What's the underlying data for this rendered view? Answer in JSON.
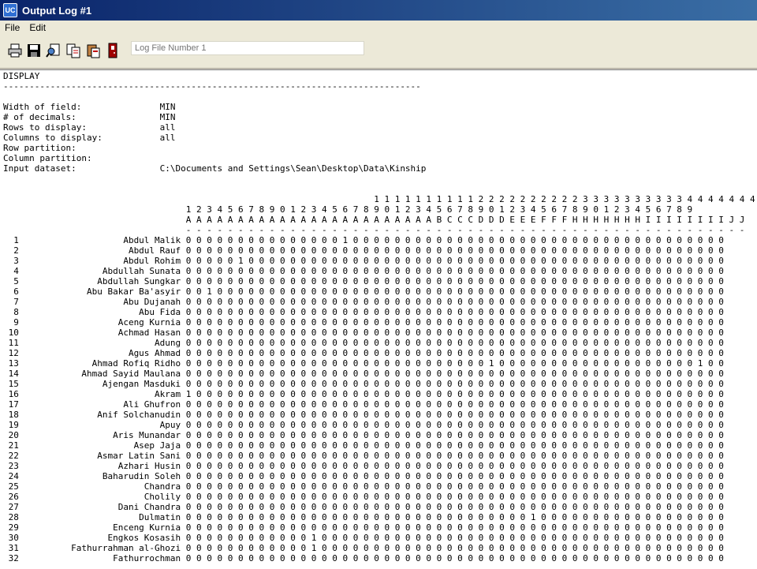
{
  "window": {
    "title": "Output Log #1",
    "app_icon_text": "UC"
  },
  "menu": {
    "items": [
      "File",
      "Edit"
    ]
  },
  "toolbar": {
    "buttons": [
      {
        "name": "print-icon"
      },
      {
        "name": "save-icon"
      },
      {
        "name": "find-icon"
      },
      {
        "name": "copy-icon"
      },
      {
        "name": "paste-icon"
      },
      {
        "name": "exit-icon"
      }
    ],
    "log_field": {
      "placeholder": "Log File Number 1"
    }
  },
  "log": {
    "header": "DISPLAY",
    "rule": "--------------------------------------------------------------------------------",
    "settings": [
      {
        "label": "Width of field:",
        "value": "MIN"
      },
      {
        "label": "# of decimals:",
        "value": "MIN"
      },
      {
        "label": "Rows to display:",
        "value": "all"
      },
      {
        "label": "Columns to display:",
        "value": "all"
      },
      {
        "label": "Row partition:",
        "value": ""
      },
      {
        "label": "Column partition:",
        "value": ""
      },
      {
        "label": "Input dataset:",
        "value": "C:\\Documents and Settings\\Sean\\Desktop\\Data\\Kinship"
      }
    ],
    "col_header_tens": "                  111111111122222222223333333333444444444",
    "col_header_ones": "1234567890123456789012345678901234567890123456789",
    "col_header_letters": "AAAAAAAAAAAAAAAAAAAAAAAABCCCDDDEEEFFFHHHHHHHIIIIIIIIJJ",
    "rows": [
      {
        "n": "1",
        "name": "Abdul Malik",
        "values": "0000000000000001000000000000000000000000000000000000"
      },
      {
        "n": "2",
        "name": "Abdul Rauf",
        "values": "0000000000000000000000000000000000000000000000000000"
      },
      {
        "n": "3",
        "name": "Abdul Rohim",
        "values": "0000010000000000000000000000000000000000000000000000"
      },
      {
        "n": "4",
        "name": "Abdullah Sunata",
        "values": "0000000000000000000000000000000000000000000000000000"
      },
      {
        "n": "5",
        "name": "Abdullah Sungkar",
        "values": "0000000000000000000000000000000000000000000000000000"
      },
      {
        "n": "6",
        "name": "Abu Bakar Ba'asyir",
        "values": "0010000000000000000000000000000000000000000000000000"
      },
      {
        "n": "7",
        "name": "Abu Dujanah",
        "values": "0000000000000000000000000000000000000000000000000000"
      },
      {
        "n": "8",
        "name": "Abu Fida",
        "values": "0000000000000000000000000000000000000000000000000000"
      },
      {
        "n": "9",
        "name": "Aceng Kurnia",
        "values": "0000000000000000000000000000000000000000000000000000"
      },
      {
        "n": "10",
        "name": "Achmad Hasan",
        "values": "0000000000000000000000000000000000000000000000000000"
      },
      {
        "n": "11",
        "name": "Adung",
        "values": "0000000000000000000000000000000000000000000000000000"
      },
      {
        "n": "12",
        "name": "Agus Ahmad",
        "values": "0000000000000000000000000000000000000000000000000000"
      },
      {
        "n": "13",
        "name": "Ahmad Rofiq Ridho",
        "values": "0000000000000000000000000000010000000000000000000100"
      },
      {
        "n": "14",
        "name": "Ahmad Sayid Maulana",
        "values": "0000000000000000000000000000000000000000000000000000"
      },
      {
        "n": "15",
        "name": "Ajengan Masduki",
        "values": "0000000000000000000000000000000000000000000000000000"
      },
      {
        "n": "16",
        "name": "Akram",
        "values": "1000000000000000000000000000000000000000000000000000"
      },
      {
        "n": "17",
        "name": "Ali Ghufron",
        "values": "0000000000000000000000000000000000000000000000000000"
      },
      {
        "n": "18",
        "name": "Anif Solchanudin",
        "values": "0000000000000000000000000000000000000000000000000000"
      },
      {
        "n": "19",
        "name": "Apuy",
        "values": "0000000000000000000000000000000000000000000000000000"
      },
      {
        "n": "20",
        "name": "Aris Munandar",
        "values": "0000000000000000000000000000000000000000000000000000"
      },
      {
        "n": "21",
        "name": "Asep Jaja",
        "values": "0000000000000000000000000000000000000000000000000000"
      },
      {
        "n": "22",
        "name": "Asmar Latin Sani",
        "values": "0000000000000000000000000000000000000000000000000000"
      },
      {
        "n": "23",
        "name": "Azhari Husin",
        "values": "0000000000000000000000000000000000000000000000000000"
      },
      {
        "n": "24",
        "name": "Baharudin Soleh",
        "values": "0000000000000000000000000000000000000000000000000000"
      },
      {
        "n": "25",
        "name": "Chandra",
        "values": "0000000000000000000000000000000000000000000000000000"
      },
      {
        "n": "26",
        "name": "Cholily",
        "values": "0000000000000000000000000000000000000000000000000000"
      },
      {
        "n": "27",
        "name": "Dani Chandra",
        "values": "0000000000000000000000000000000000000000000000000000"
      },
      {
        "n": "28",
        "name": "Dulmatin",
        "values": "0000000000000000000000000000000001000000000000000000"
      },
      {
        "n": "29",
        "name": "Enceng Kurnia",
        "values": "0000000000000000000000000000000000000000000000000000"
      },
      {
        "n": "30",
        "name": "Engkos Kosasih",
        "values": "0000000000001000000000000000000000000000000000000000"
      },
      {
        "n": "31",
        "name": "Fathurrahman al-Ghozi",
        "values": "0000000000001000000000000000000000000000000000000000"
      },
      {
        "n": "32",
        "name": "Fathurrochman",
        "values": "0000000000000000000000000000000000000000000000000000"
      }
    ]
  }
}
